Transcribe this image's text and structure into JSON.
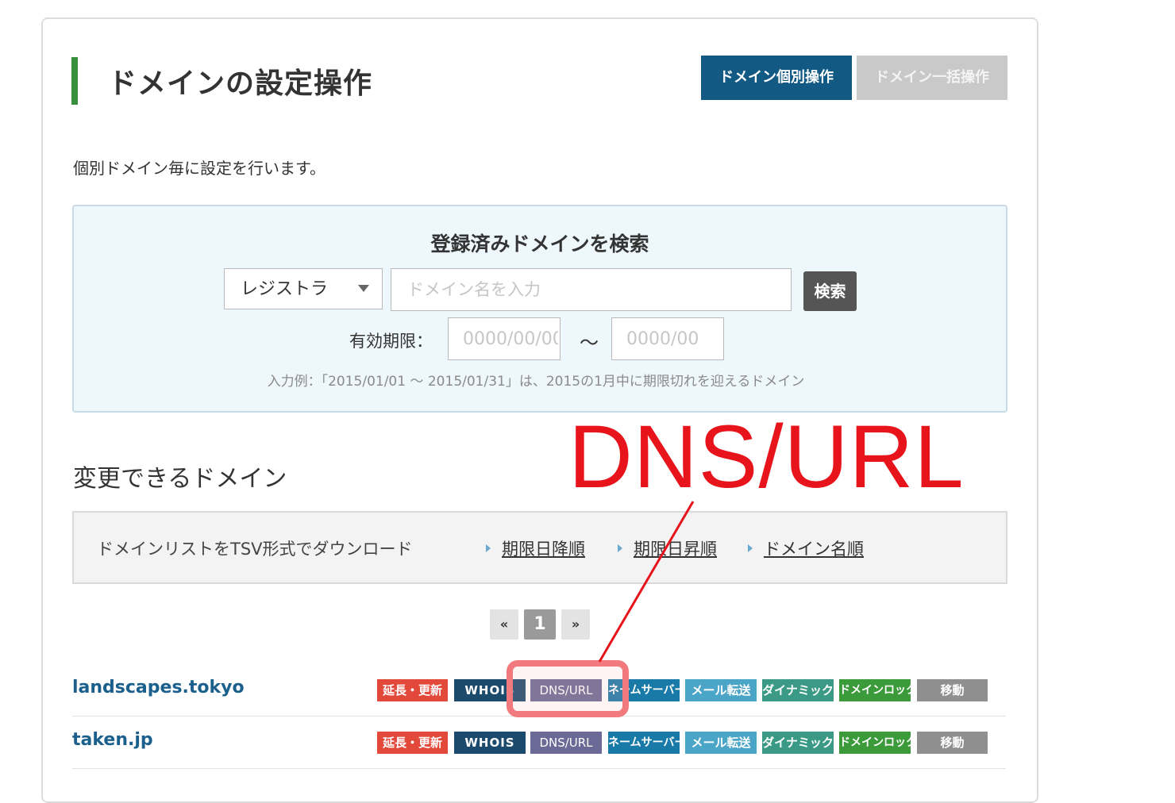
{
  "header": {
    "title": "ドメインの設定操作",
    "tab_individual": "ドメイン個別操作",
    "tab_bulk": "ドメイン一括操作"
  },
  "intro": "個別ドメイン毎に設定を行います。",
  "search": {
    "title": "登録済みドメインを検索",
    "select_value": "レジストラ",
    "input_placeholder": "ドメイン名を入力",
    "button": "検索",
    "expiry_label": "有効期限：",
    "date_from_placeholder": "0000/00/00",
    "date_to_placeholder": "0000/00",
    "tilde": "～",
    "example": "入力例：「2015/01/01 ～ 2015/01/31」は、2015の1月中に期限切れを迎えるドメイン"
  },
  "domains_section": {
    "title": "変更できるドメイン",
    "download_label": "ドメインリストをTSV形式でダウンロード",
    "sort_links": [
      "期限日降順",
      "期限日昇順",
      "ドメイン名順"
    ]
  },
  "pagination": {
    "prev": "«",
    "current": "1",
    "next": "»"
  },
  "action_labels": {
    "renew": "延長・更新",
    "whois": "WHOIS",
    "dns": "DNS/URL",
    "nameserver": "ネームサーバー",
    "mail": "メール転送",
    "dynamic": "ダイナミック",
    "lock": "ドメインロック",
    "move": "移動"
  },
  "domains": [
    {
      "name": "landscapes.tokyo"
    },
    {
      "name": "taken.jp"
    }
  ],
  "annotation": {
    "text": "DNS/URL",
    "color": "#e8141c"
  },
  "colors": {
    "accent_green": "#3a8f3f",
    "primary_blue": "#125a84",
    "link_blue": "#1b5f8c"
  }
}
